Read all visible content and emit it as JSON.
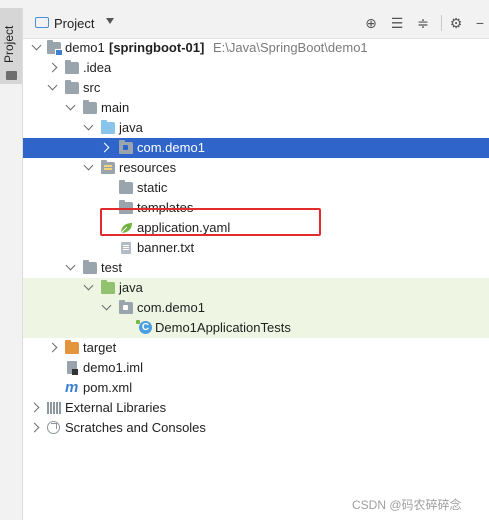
{
  "sidebar": {
    "tab_label": "Project"
  },
  "header": {
    "title": "Project"
  },
  "tree": {
    "root": {
      "name": "demo1",
      "module": "[springboot-01]",
      "path": "E:\\Java\\SpringBoot\\demo1"
    },
    "idea": ".idea",
    "src": "src",
    "main": "main",
    "main_java": "java",
    "pkg_main": "com.demo1",
    "resources": "resources",
    "static": "static",
    "templates": "templates",
    "application_yaml": "application.yaml",
    "banner": "banner.txt",
    "test": "test",
    "test_java": "java",
    "pkg_test": "com.demo1",
    "test_class": "Demo1ApplicationTests",
    "target": "target",
    "iml": "demo1.iml",
    "pom": "pom.xml",
    "ext_libs": "External Libraries",
    "scratches": "Scratches and Consoles"
  },
  "highlight_color": "#e32b2b",
  "selection_color": "#2f65ca",
  "watermark": "CSDN @码农碎碎念"
}
